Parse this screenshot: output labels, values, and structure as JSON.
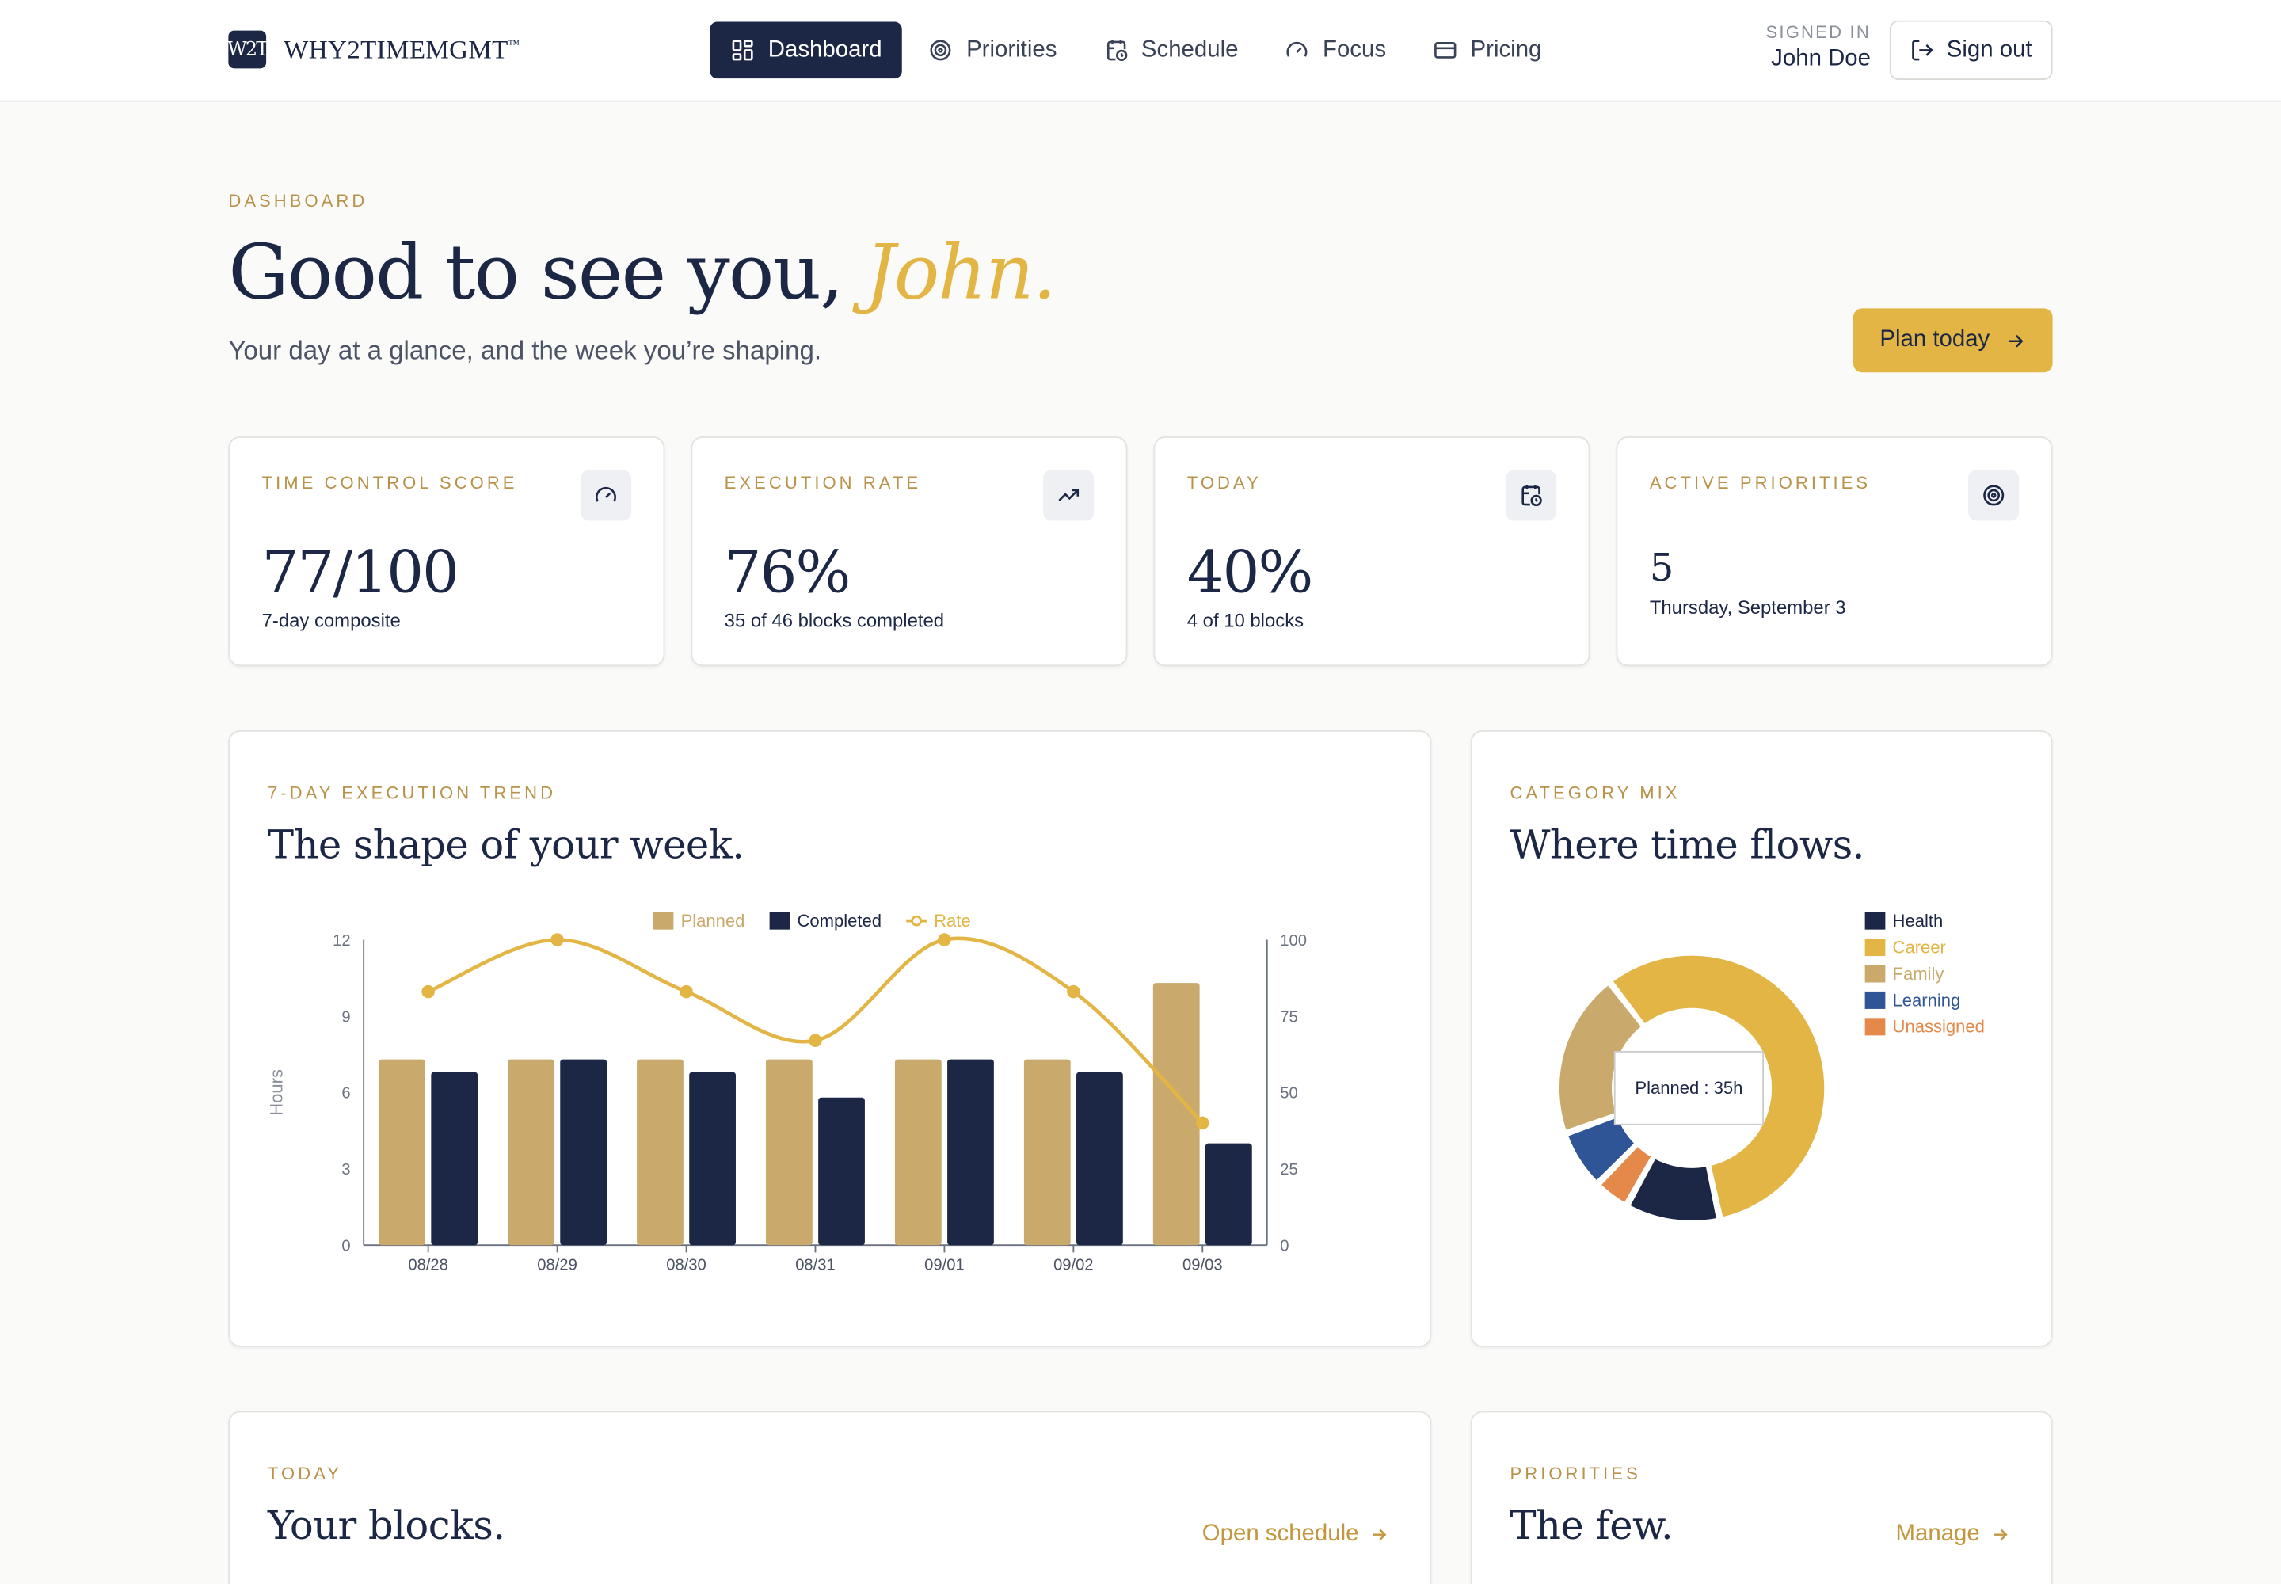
{
  "brand": {
    "mark": "W2T",
    "name": "WHY2TIMEMGMT",
    "tm": "™"
  },
  "nav": [
    {
      "label": "Dashboard",
      "icon": "dashboard-icon",
      "active": true
    },
    {
      "label": "Priorities",
      "icon": "target-icon"
    },
    {
      "label": "Schedule",
      "icon": "calendar-clock-icon"
    },
    {
      "label": "Focus",
      "icon": "gauge-icon"
    },
    {
      "label": "Pricing",
      "icon": "credit-card-icon"
    }
  ],
  "user": {
    "signed_in_label": "SIGNED IN",
    "name": "John Doe",
    "signout_label": "Sign out"
  },
  "page": {
    "eyebrow": "DASHBOARD",
    "greeting": "Good to see you,",
    "greeting_name": "John.",
    "subtitle": "Your day at a glance, and the week you’re shaping.",
    "plan_label": "Plan today"
  },
  "kpis": [
    {
      "label": "TIME CONTROL SCORE",
      "value": "77/100",
      "note": "7-day composite",
      "icon": "gauge-icon"
    },
    {
      "label": "EXECUTION RATE",
      "value": "76%",
      "note": "35 of 46 blocks completed",
      "icon": "trending-up-icon"
    },
    {
      "label": "TODAY",
      "value": "40%",
      "note": "4 of 10 blocks",
      "icon": "calendar-clock-icon"
    },
    {
      "label": "ACTIVE PRIORITIES",
      "value": "5",
      "note": "Thursday, September 3",
      "icon": "target-icon"
    }
  ],
  "trend_card": {
    "eyebrow": "7-DAY EXECUTION TREND",
    "title": "The shape of your week."
  },
  "mix_card": {
    "eyebrow": "CATEGORY MIX",
    "title": "Where time flows.",
    "tooltip": "Planned : 35h"
  },
  "blocks_card": {
    "eyebrow": "TODAY",
    "title": "Your blocks.",
    "link": "Open schedule"
  },
  "priorities_card": {
    "eyebrow": "PRIORITIES",
    "title": "The few.",
    "link": "Manage"
  },
  "colors": {
    "navy": "#1c2746",
    "gold": "#e3b544",
    "tan": "#c9aa6c",
    "blue": "#2f5597",
    "orange": "#e4894a"
  },
  "chart_data": [
    {
      "type": "bar",
      "categories": [
        "08/28",
        "08/29",
        "08/30",
        "08/31",
        "09/01",
        "09/02",
        "09/03"
      ],
      "series": [
        {
          "name": "Planned",
          "kind": "bar",
          "axis": "left",
          "color": "#c9aa6c",
          "values": [
            7.3,
            7.3,
            7.3,
            7.3,
            7.3,
            7.3,
            10.3
          ]
        },
        {
          "name": "Completed",
          "kind": "bar",
          "axis": "left",
          "color": "#1c2746",
          "values": [
            6.8,
            7.3,
            6.8,
            5.8,
            7.3,
            6.8,
            4.0
          ]
        },
        {
          "name": "Rate",
          "kind": "line",
          "axis": "right",
          "color": "#e3b544",
          "values": [
            83,
            100,
            83,
            67,
            100,
            83,
            40
          ]
        }
      ],
      "ylabel": "Hours",
      "ylim": [
        0,
        12
      ],
      "yticks": [
        0,
        3,
        6,
        9,
        12
      ],
      "y2lim": [
        0,
        100
      ],
      "y2ticks": [
        0,
        25,
        50,
        75,
        100
      ],
      "legend": "top-center"
    },
    {
      "type": "pie",
      "donut": true,
      "labels": [
        "Career",
        "Health",
        "Unassigned",
        "Learning",
        "Family"
      ],
      "values": [
        20,
        4,
        1.5,
        2.5,
        7
      ],
      "colors": [
        "#e3b544",
        "#1c2746",
        "#e4894a",
        "#2f5597",
        "#c9aa6c"
      ],
      "legend_order": [
        "Health",
        "Career",
        "Family",
        "Learning",
        "Unassigned"
      ],
      "legend": "top-right"
    }
  ]
}
